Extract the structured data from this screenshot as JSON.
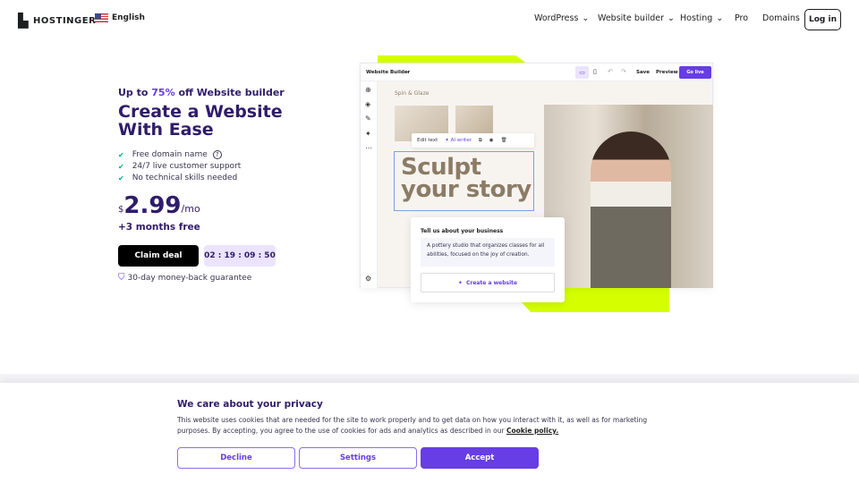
{
  "nav": {
    "brand": "HOSTINGER",
    "language": "English",
    "items": [
      {
        "label": "WordPress",
        "dropdown": true
      },
      {
        "label": "Website builder",
        "dropdown": true
      },
      {
        "label": "Hosting",
        "dropdown": true
      },
      {
        "label": "Pro",
        "dropdown": false
      },
      {
        "label": "Domains",
        "dropdown": false
      }
    ],
    "login": "Log in"
  },
  "hero": {
    "promo_prefix": "Up to ",
    "promo_pct": "75%",
    "promo_suffix": " off Website builder",
    "title": "Create a Website With Ease",
    "features": [
      "Free domain name",
      "24/7 live customer support",
      "No technical skills needed"
    ],
    "currency": "$",
    "price": "2.99",
    "period": "/mo",
    "bonus": "+3 months free",
    "cta": "Claim deal",
    "timer": "02 : 19 : 09 : 50",
    "guarantee": "30-day money-back guarantee"
  },
  "builder": {
    "title": "Website Builder",
    "save": "Save",
    "preview": "Preview",
    "go_live": "Go live",
    "site_name": "Spin & Glaze",
    "edit_text": "Edit text",
    "ai_writer": "AI writer",
    "headline": "Sculpt your story",
    "prompt_title": "Tell us about your business",
    "prompt_text": "A pottery studio that organizes classes for all abilities, focused on the joy of creation.",
    "create": "Create a website"
  },
  "cookie": {
    "title": "We care about your privacy",
    "text": "This website uses cookies that are needed for the site to work properly and to get data on how you interact with it, as well as for marketing purposes. By accepting, you agree to the use of cookies for ads and analytics as described in our ",
    "link": "Cookie policy.",
    "decline": "Decline",
    "settings": "Settings",
    "accept": "Accept"
  },
  "colors": {
    "accent": "#673de6",
    "lime": "#d5ff00",
    "text": "#2f1c6a"
  }
}
